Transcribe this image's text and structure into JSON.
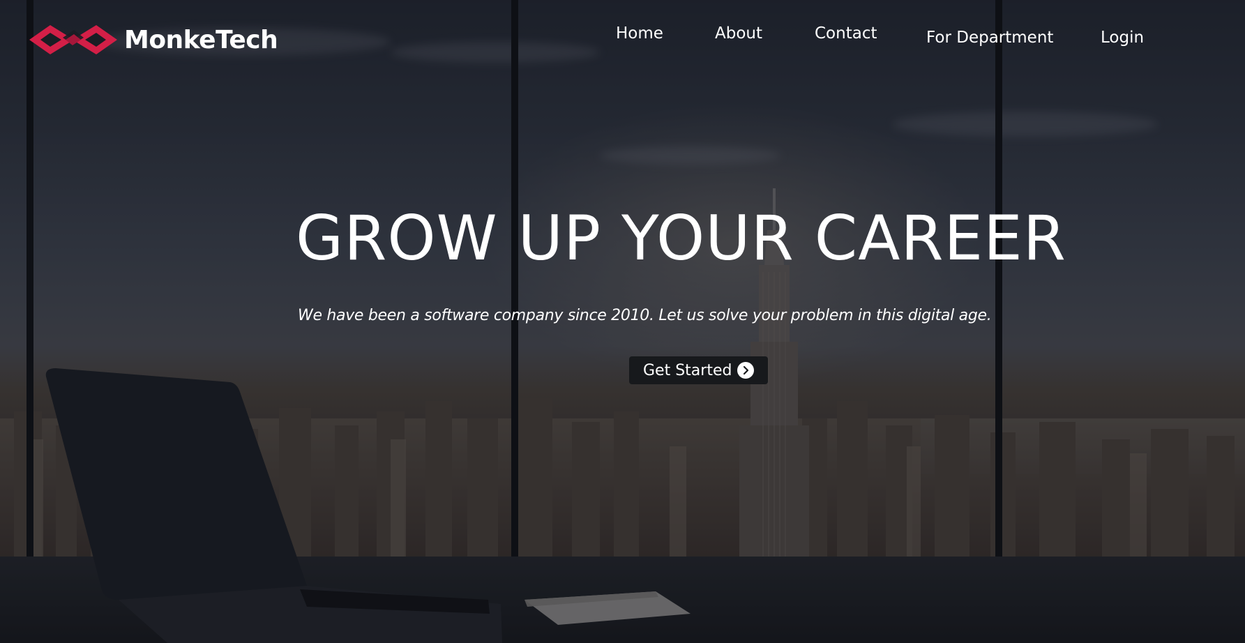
{
  "brand": {
    "name": "MonkeTech",
    "logo_icon": "infinity-link-logo",
    "logo_color": "#d31f47"
  },
  "nav": {
    "items": [
      {
        "label": "Home"
      },
      {
        "label": "About"
      },
      {
        "label": "Contact"
      },
      {
        "label": "For Department"
      },
      {
        "label": "Login"
      }
    ]
  },
  "hero": {
    "title": "GROW UP YOUR CAREER",
    "subtitle": "We have been a software company since 2010. Let us solve your problem in this digital age.",
    "cta_label": "Get Started",
    "cta_icon": "chevron-right-circle-icon",
    "background": "city-skyline-office-photo"
  },
  "colors": {
    "text": "#ffffff",
    "accent": "#d31f47",
    "button_bg": "#17191c"
  }
}
